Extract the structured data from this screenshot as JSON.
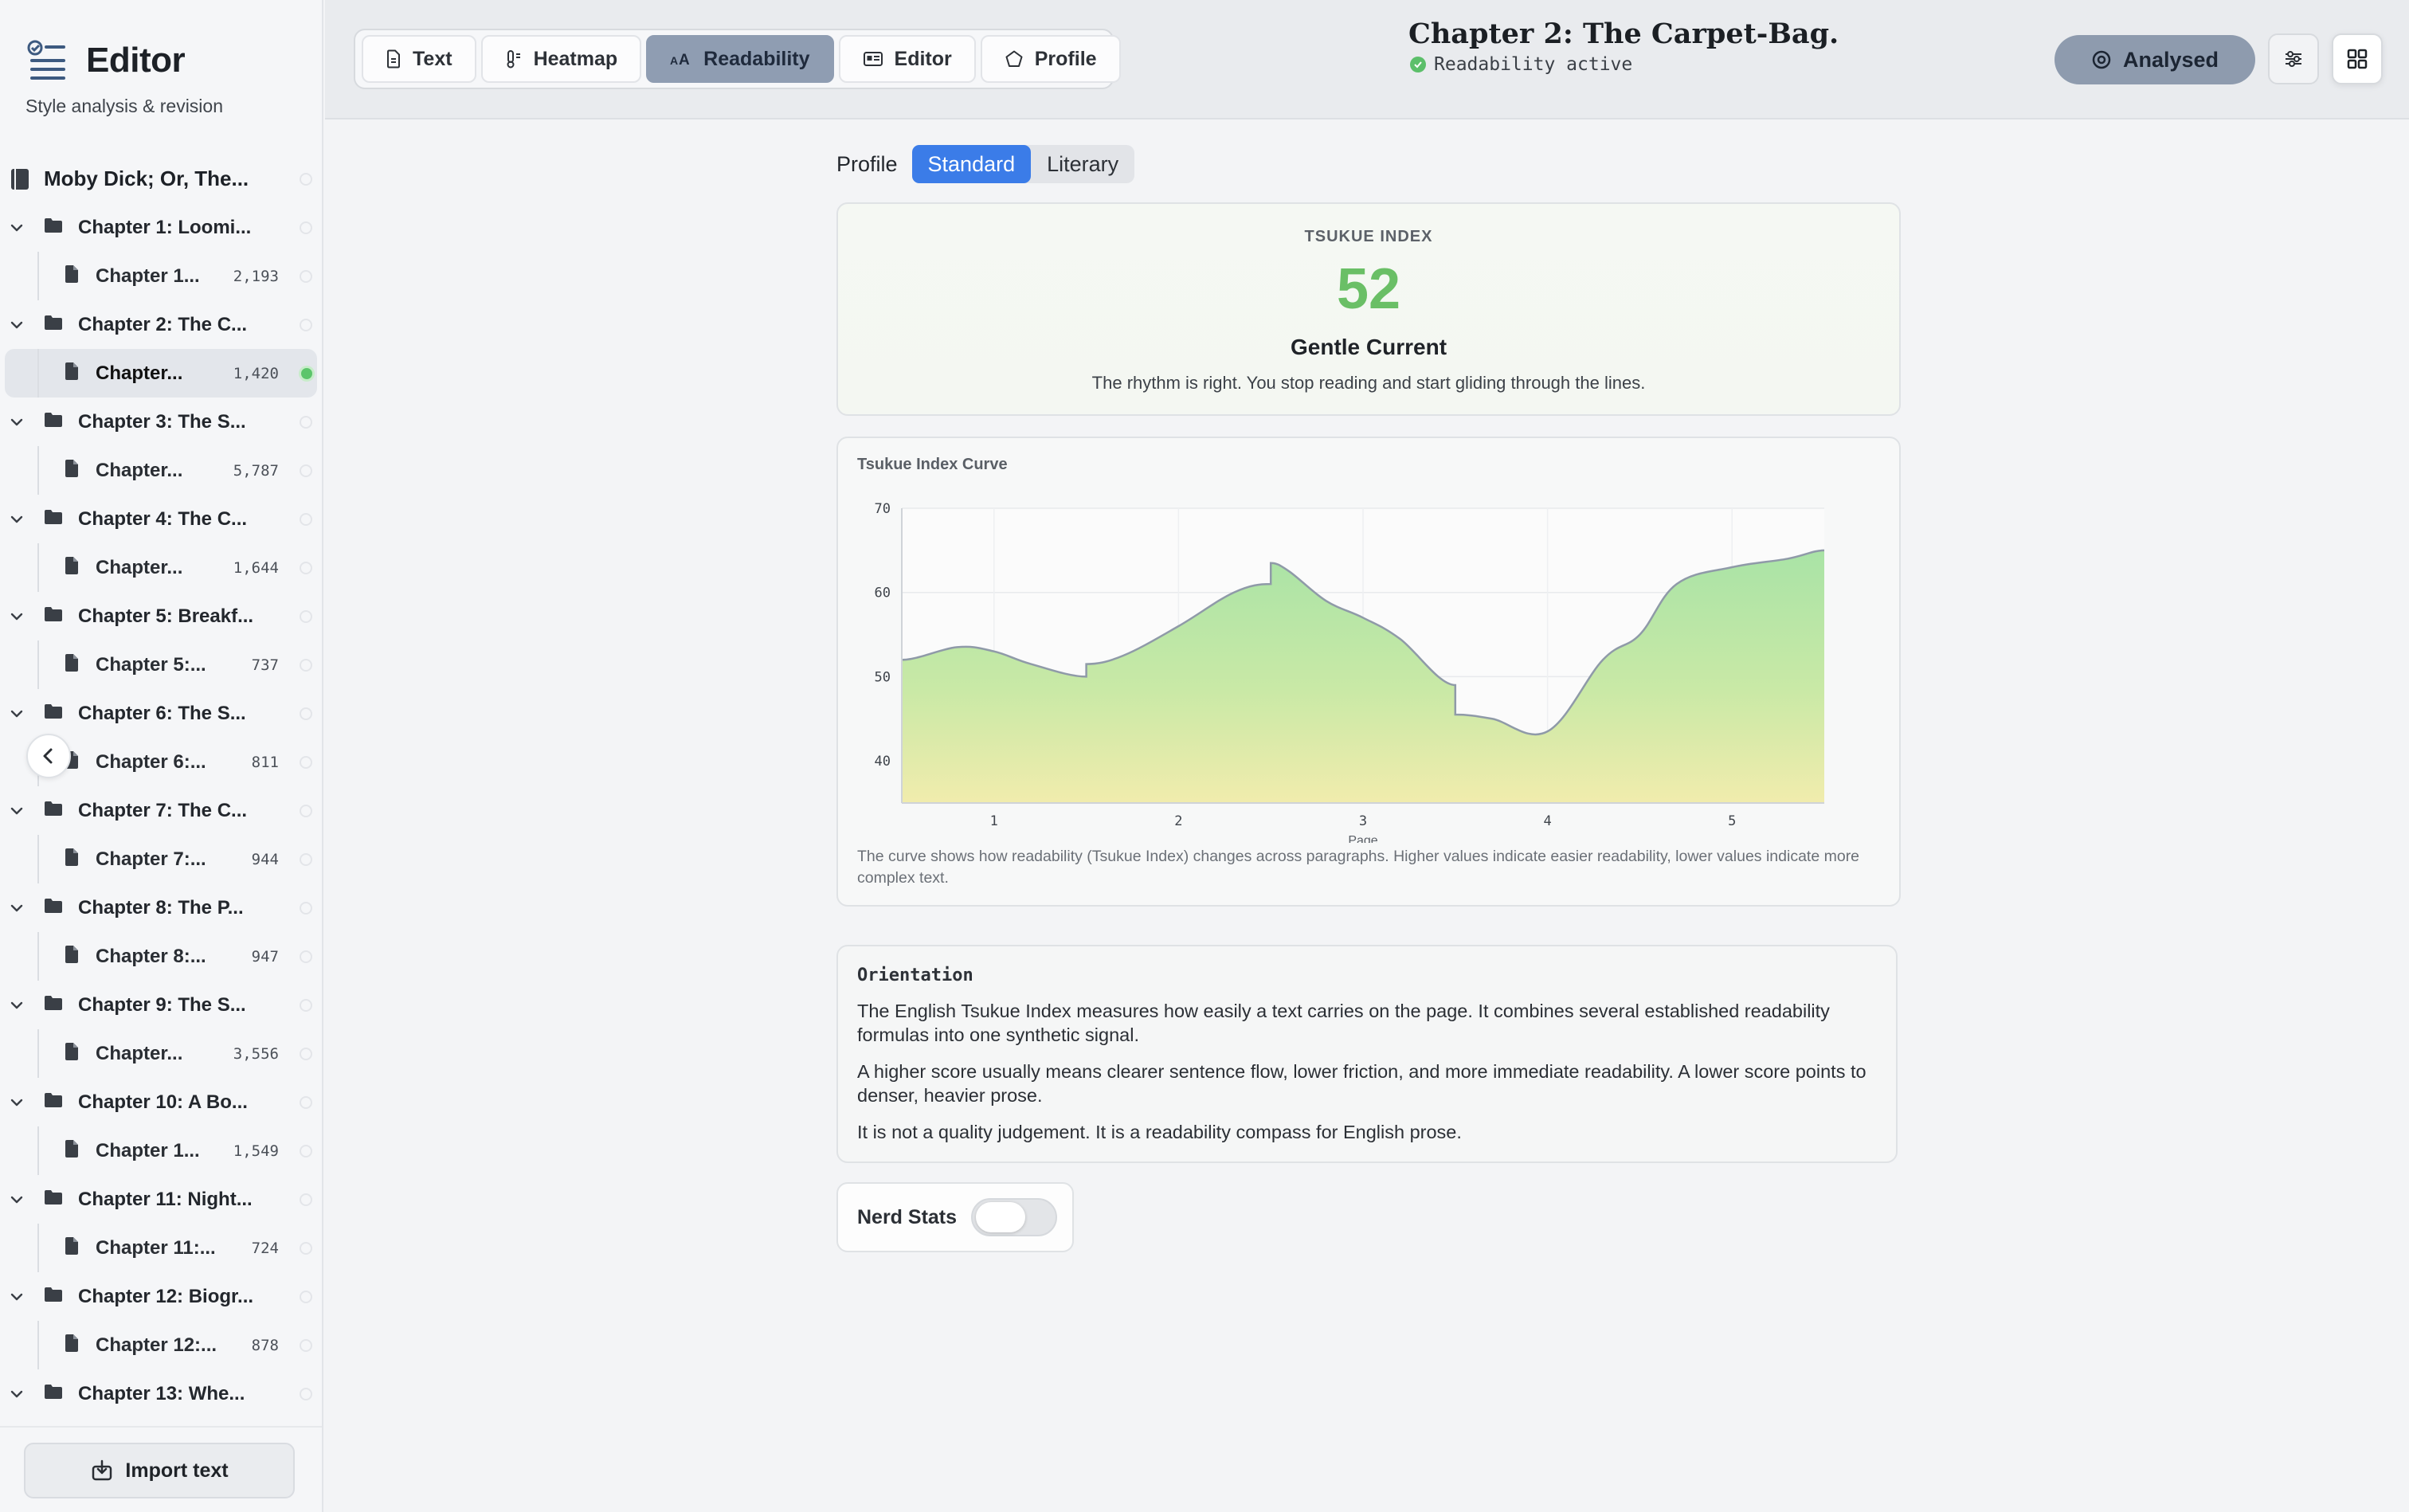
{
  "sidebar": {
    "app_title": "Editor",
    "subtitle": "Style analysis & revision",
    "book": "Moby Dick; Or, The...",
    "chapters": [
      {
        "folder": "Chapter 1: Loomi...",
        "doc": "Chapter 1...",
        "count": "2,193",
        "selected": false
      },
      {
        "folder": "Chapter 2: The C...",
        "doc": "Chapter...",
        "count": "1,420",
        "selected": true
      },
      {
        "folder": "Chapter 3: The S...",
        "doc": "Chapter...",
        "count": "5,787",
        "selected": false
      },
      {
        "folder": "Chapter 4: The C...",
        "doc": "Chapter...",
        "count": "1,644",
        "selected": false
      },
      {
        "folder": "Chapter 5: Breakf...",
        "doc": "Chapter 5:...",
        "count": "737",
        "selected": false
      },
      {
        "folder": "Chapter 6: The S...",
        "doc": "Chapter 6:...",
        "count": "811",
        "selected": false
      },
      {
        "folder": "Chapter 7: The C...",
        "doc": "Chapter 7:...",
        "count": "944",
        "selected": false
      },
      {
        "folder": "Chapter 8: The P...",
        "doc": "Chapter 8:...",
        "count": "947",
        "selected": false
      },
      {
        "folder": "Chapter 9: The S...",
        "doc": "Chapter...",
        "count": "3,556",
        "selected": false
      },
      {
        "folder": "Chapter 10: A Bo...",
        "doc": "Chapter 1...",
        "count": "1,549",
        "selected": false
      },
      {
        "folder": "Chapter 11: Night...",
        "doc": "Chapter 11:...",
        "count": "724",
        "selected": false
      },
      {
        "folder": "Chapter 12: Biogr...",
        "doc": "Chapter 12:...",
        "count": "878",
        "selected": false
      },
      {
        "folder": "Chapter 13: Whe...",
        "doc": null,
        "count": null,
        "selected": false
      }
    ],
    "import_label": "Import text"
  },
  "header": {
    "tabs": [
      {
        "label": "Text",
        "icon": "document-icon",
        "active": false
      },
      {
        "label": "Heatmap",
        "icon": "thermometer-icon",
        "active": false
      },
      {
        "label": "Readability",
        "icon": "text-size-icon",
        "active": true
      },
      {
        "label": "Editor",
        "icon": "id-card-icon",
        "active": false
      },
      {
        "label": "Profile",
        "icon": "pentagon-icon",
        "active": false
      }
    ],
    "chapter_title": "Chapter 2: The Carpet-Bag.",
    "status": "Readability active",
    "analysed_label": "Analysed",
    "settings_icon": "sliders-icon",
    "grid_icon": "grid-icon"
  },
  "profile": {
    "label": "Profile",
    "options": [
      "Standard",
      "Literary"
    ],
    "selected": "Standard"
  },
  "index_card": {
    "kicker": "TSUKUE INDEX",
    "score": "52",
    "grade": "Gentle Current",
    "description": "The rhythm is right. You stop reading and start gliding through the lines."
  },
  "curve_card": {
    "title": "Tsukue Index Curve",
    "note": "The curve shows how readability (Tsukue Index) changes across paragraphs. Higher values indicate easier readability, lower values indicate more complex text."
  },
  "chart_data": {
    "type": "area",
    "title": "Tsukue Index Curve",
    "xlabel": "Page",
    "ylabel": "",
    "xlim": [
      0.5,
      5.5
    ],
    "ylim": [
      35,
      70
    ],
    "xticks": [
      1,
      2,
      3,
      4,
      5
    ],
    "yticks": [
      40,
      50,
      60,
      70
    ],
    "grid": true,
    "x": [
      0.5,
      0.8,
      1.0,
      1.2,
      1.5,
      1.5,
      1.7,
      2.0,
      2.3,
      2.5,
      2.5,
      2.6,
      2.8,
      3.0,
      3.2,
      3.5,
      3.5,
      3.7,
      4.0,
      4.3,
      4.5,
      4.7,
      5.0,
      5.3,
      5.5
    ],
    "y": [
      52,
      53.5,
      53,
      51.5,
      50,
      51.5,
      52.5,
      56,
      60,
      61,
      63.5,
      62.5,
      59,
      57,
      54.5,
      49,
      45.5,
      45,
      43.5,
      52,
      55,
      61,
      63,
      64,
      65
    ]
  },
  "orientation": {
    "title": "Orientation",
    "paragraphs": [
      "The English Tsukue Index measures how easily a text carries on the page. It combines several established readability formulas into one synthetic signal.",
      "A higher score usually means clearer sentence flow, lower friction, and more immediate readability. A lower score points to denser, heavier prose.",
      "It is not a quality judgement. It is a readability compass for English prose."
    ]
  },
  "nerd_stats": {
    "label": "Nerd Stats",
    "enabled": false
  }
}
